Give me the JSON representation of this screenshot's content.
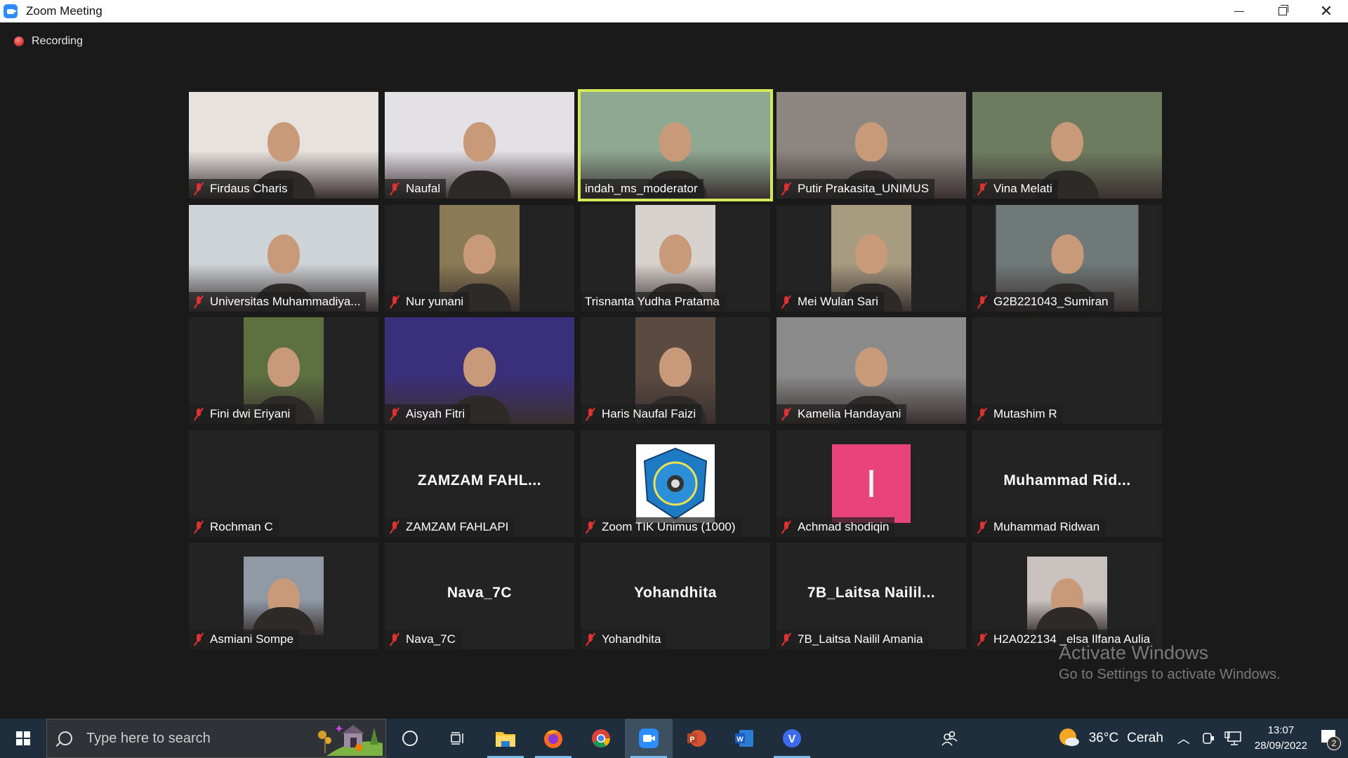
{
  "window": {
    "title": "Zoom Meeting",
    "app_icon": "zoom-camera-icon",
    "controls": [
      "minimize-icon",
      "restore-icon",
      "close-icon"
    ]
  },
  "recording": {
    "label": "Recording",
    "icon": "recording-dot-icon"
  },
  "participants": [
    {
      "name": "Firdaus Charis",
      "muted": true,
      "video": "on",
      "bg": "#e8e2de"
    },
    {
      "name": "Naufal",
      "muted": true,
      "video": "on",
      "bg": "#e3e0e6"
    },
    {
      "name": "indah_ms_moderator",
      "muted": false,
      "video": "on",
      "active_speaker": true,
      "bg": "#8ea892"
    },
    {
      "name": "Putir Prakasita_UNIMUS",
      "muted": true,
      "video": "on",
      "bg": "#8c8580"
    },
    {
      "name": "Vina Melati",
      "muted": true,
      "video": "on",
      "bg": "#6d7b5e"
    },
    {
      "name": "Universitas Muhammadiya...",
      "muted": true,
      "video": "on",
      "bg": "#cfd4d8"
    },
    {
      "name": "Nur yunani",
      "muted": true,
      "video": "narrow",
      "bg": "#8a7a55"
    },
    {
      "name": "Trisnanta Yudha Pratama",
      "muted": false,
      "video": "narrow",
      "bg": "#d8d2ce"
    },
    {
      "name": "Mei Wulan Sari",
      "muted": true,
      "video": "narrow",
      "bg": "#a79b80"
    },
    {
      "name": "G2B221043_Sumiran",
      "muted": true,
      "video": "mid",
      "bg": "#6f7a78"
    },
    {
      "name": "Fini dwi Eriyani",
      "muted": true,
      "video": "narrow",
      "bg": "#5c7040"
    },
    {
      "name": "Aisyah Fitri",
      "muted": true,
      "video": "on",
      "bg": "#3a2f7a"
    },
    {
      "name": "Haris Naufal Faizi",
      "muted": true,
      "video": "narrow",
      "bg": "#5a4a40"
    },
    {
      "name": "Kamelia Handayani",
      "muted": true,
      "video": "on",
      "bg": "#8a8a8a"
    },
    {
      "name": "Mutashim R",
      "muted": true,
      "video": "off"
    },
    {
      "name": "Rochman C",
      "muted": true,
      "video": "off"
    },
    {
      "name": "ZAMZAM FAHLAPI",
      "muted": true,
      "video": "off",
      "display_name": "ZAMZAM  FAHL..."
    },
    {
      "name": "Zoom TIK Unimus (1000)",
      "muted": true,
      "video": "logo"
    },
    {
      "name": "Achmad shodiqin",
      "muted": true,
      "video": "avatar",
      "avatar_letter": "I",
      "avatar_color": "#e8437a"
    },
    {
      "name": "Muhammad Ridwan",
      "muted": true,
      "video": "off",
      "display_name": "Muhammad  Rid..."
    },
    {
      "name": "Asmiani Sompe",
      "muted": true,
      "video": "photo",
      "bg": "#8f9aa5"
    },
    {
      "name": "Nava_7C",
      "muted": true,
      "video": "off",
      "display_name": "Nava_7C"
    },
    {
      "name": "Yohandhita",
      "muted": true,
      "video": "off",
      "display_name": "Yohandhita"
    },
    {
      "name": "7B_Laitsa Nailil Amania",
      "muted": true,
      "video": "off",
      "display_name": "7B_Laitsa  Nailil..."
    },
    {
      "name": "H2A022134 _elsa Ilfana Aulia",
      "muted": true,
      "video": "photo",
      "bg": "#c9c2bf"
    }
  ],
  "watermark": {
    "line1": "Activate Windows",
    "line2": "Go to Settings to activate Windows."
  },
  "taskbar": {
    "search_placeholder": "Type here to search",
    "apps": [
      {
        "name": "cortana",
        "icon": "cortana-circle-icon"
      },
      {
        "name": "task-view",
        "icon": "task-view-icon"
      },
      {
        "name": "file-explorer",
        "icon": "folder-icon",
        "running": true
      },
      {
        "name": "firefox",
        "icon": "firefox-icon",
        "running": true
      },
      {
        "name": "chrome",
        "icon": "chrome-icon"
      },
      {
        "name": "zoom",
        "icon": "zoom-icon",
        "running": true,
        "active": true
      },
      {
        "name": "powerpoint",
        "icon": "powerpoint-icon"
      },
      {
        "name": "word",
        "icon": "word-icon"
      },
      {
        "name": "v-app",
        "icon": "v-circle-icon",
        "running": true
      }
    ],
    "weather": {
      "temp": "36°C",
      "condition": "Cerah"
    },
    "time": "13:07",
    "date": "28/09/2022",
    "notifications": "2"
  }
}
